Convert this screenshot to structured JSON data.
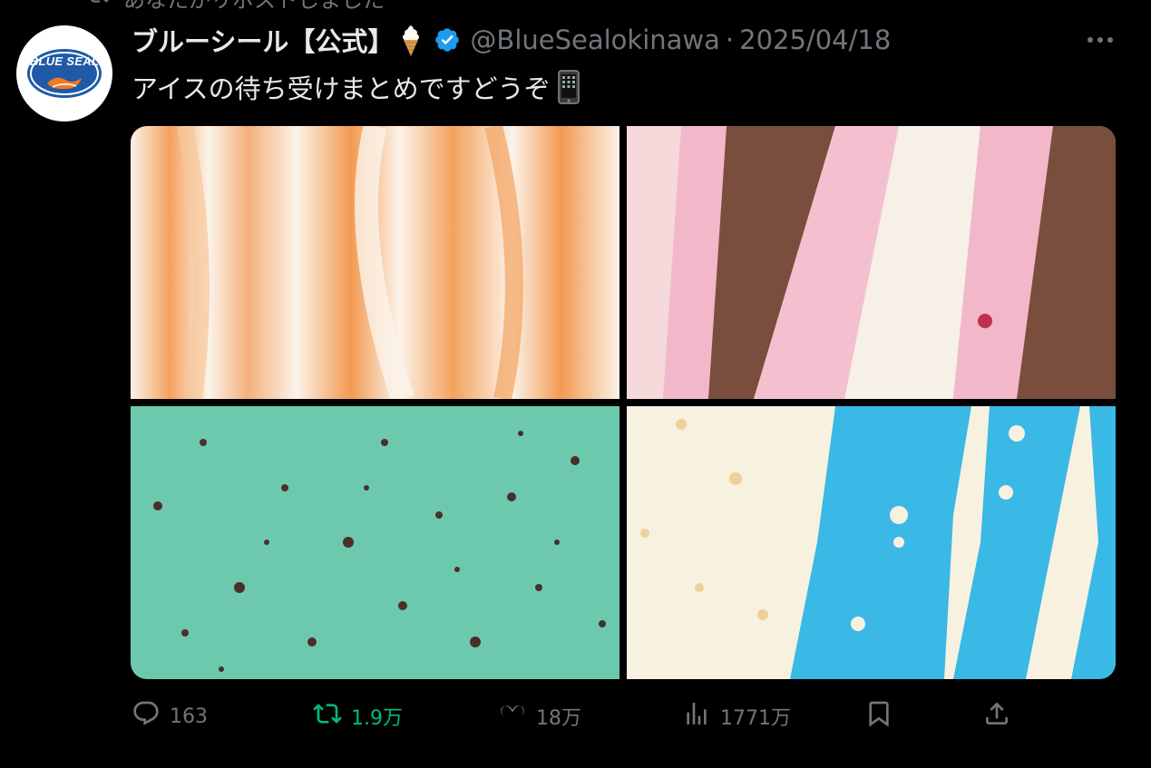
{
  "retweet_notice": "あなたがリポストしました",
  "author": {
    "name": "ブルーシール【公式】",
    "name_emoji": "soft-ice-cream-emoji",
    "verified": true,
    "handle": "@BlueSealokinawa",
    "separator": "·",
    "date": "2025/04/18",
    "avatar_logo_text": "BLUE SEAL"
  },
  "tweet": {
    "text": "アイスの待ち受けまとめですどうぞ",
    "text_emoji": "mobile-phone-emoji"
  },
  "media": [
    {
      "name": "orange-swirl-ice-cream",
      "colors": [
        "#f4a25e",
        "#fbf3ea"
      ]
    },
    {
      "name": "pink-chocolate-ice-cream",
      "colors": [
        "#f2b7c9",
        "#7a4e3c",
        "#f6f0e8"
      ]
    },
    {
      "name": "mint-chip-ice-cream",
      "colors": [
        "#6dc9ad",
        "#4a2f2a"
      ]
    },
    {
      "name": "blue-vanilla-ice-cream",
      "colors": [
        "#3ab8e6",
        "#f7f1df"
      ]
    }
  ],
  "actions": {
    "reply_count": "163",
    "repost_count": "1.9万",
    "like_count": "18万",
    "view_count": "1771万"
  },
  "colors": {
    "background": "#000000",
    "text_primary": "#e7e9ea",
    "text_secondary": "#71767b",
    "verified_blue": "#1d9bf0",
    "repost_green": "#00ba7c",
    "brand_blue": "#1f5aa6",
    "brand_orange": "#f07a22"
  },
  "icons": {
    "reply": "speech-bubble-icon",
    "repost": "repost-arrows-icon",
    "like": "heart-icon",
    "views": "bar-chart-icon",
    "bookmark": "bookmark-icon",
    "share": "upload-share-icon",
    "more": "more-dots-icon"
  }
}
